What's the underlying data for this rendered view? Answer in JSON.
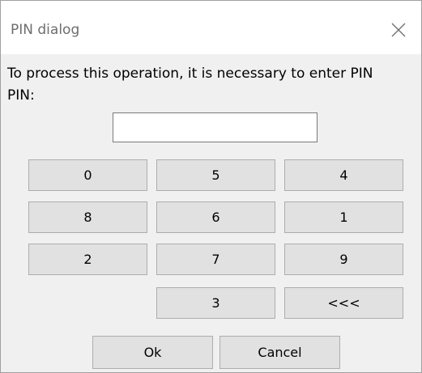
{
  "window": {
    "title": "PIN dialog",
    "close_icon": "close-icon"
  },
  "message": "To process this operation, it is necessary to enter PIN",
  "pin_field": {
    "label": "PIN:",
    "value": "",
    "placeholder": ""
  },
  "keypad": {
    "rows": [
      [
        "0",
        "5",
        "4"
      ],
      [
        "8",
        "6",
        "1"
      ],
      [
        "2",
        "7",
        "9"
      ],
      [
        "3",
        "<<<"
      ]
    ]
  },
  "actions": {
    "ok_label": "Ok",
    "cancel_label": "Cancel"
  }
}
